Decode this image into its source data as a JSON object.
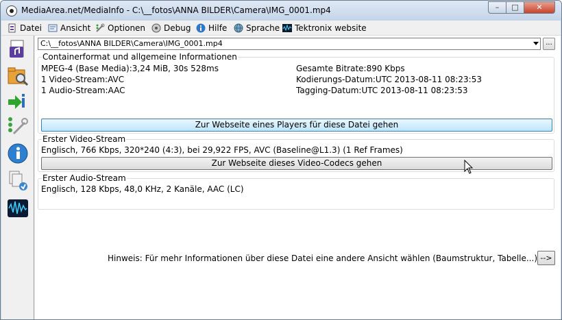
{
  "window": {
    "title": "MediaArea.net/MediaInfo - C:\\__fotos\\ANNA BILDER\\Camera\\IMG_0001.mp4",
    "buttons": {
      "minimize": "–",
      "maximize": "□",
      "close": "✕"
    }
  },
  "menu": [
    {
      "label": "Datei",
      "icon": "datei-icon"
    },
    {
      "label": "Ansicht",
      "icon": "ansicht-icon"
    },
    {
      "label": "Optionen",
      "icon": "optionen-icon"
    },
    {
      "label": "Debug",
      "icon": "debug-icon"
    },
    {
      "label": "Hilfe",
      "icon": "help-icon"
    },
    {
      "label": "Sprache",
      "icon": "globe-icon"
    },
    {
      "label": "Tektronix website",
      "icon": "tektronix-icon"
    }
  ],
  "toolbar": [
    {
      "icon": "open-file-icon"
    },
    {
      "icon": "open-folder-icon"
    },
    {
      "icon": "info-arrow-icon"
    },
    {
      "icon": "tree-view-icon"
    },
    {
      "icon": "about-icon"
    },
    {
      "icon": "export-icon"
    },
    {
      "icon": "waveform-icon"
    }
  ],
  "file": {
    "path": "C:\\__fotos\\ANNA BILDER\\Camera\\IMG_0001.mp4",
    "browse_label": "..."
  },
  "general": {
    "title": "Containerformat und allgemeine Informationen",
    "left": [
      "MPEG-4 (Base Media):3,24 MiB, 30s 528ms",
      "1 Video-Stream:AVC",
      "1 Audio-Stream:AAC"
    ],
    "right": [
      "Gesamte Bitrate:890 Kbps",
      "Kodierungs-Datum:UTC 2013-08-11 08:23:53",
      "Tagging-Datum:UTC 2013-08-11 08:23:53"
    ],
    "button": "Zur Webseite eines Players für diese Datei gehen"
  },
  "video": {
    "title": "Erster Video-Stream",
    "line": "Englisch, 766 Kbps, 320*240 (4:3), bei 29,922 FPS, AVC (Baseline@L1.3) (1 Ref Frames)",
    "button": "Zur Webseite dieses Video-Codecs gehen"
  },
  "audio": {
    "title": "Erster Audio-Stream",
    "line": "Englisch, 128 Kbps, 48,0 KHz, 2 Kanäle, AAC (LC)"
  },
  "hint": {
    "text": "Hinweis: Für mehr Informationen über diese Datei eine andere Ansicht wählen (Baumstruktur, Tabelle...)",
    "button": "-->"
  }
}
